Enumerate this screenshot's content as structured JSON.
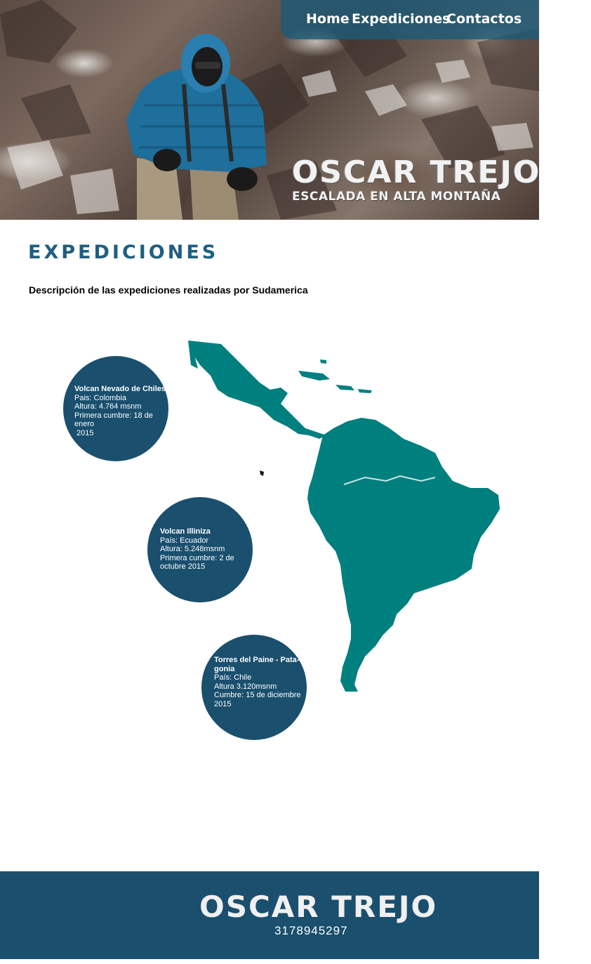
{
  "nav": {
    "items": [
      {
        "label": "Home"
      },
      {
        "label": "Expediciones"
      },
      {
        "label": "Contactos"
      }
    ]
  },
  "hero": {
    "name": "OSCAR TREJO",
    "tagline": "ESCALADA EN ALTA MONTAÑA"
  },
  "section": {
    "title": "EXPEDICIONES",
    "description": "Descripción de las expediciones realizadas por Sudamerica"
  },
  "expeditions": [
    {
      "name": "Volcan Nevado de Chiles",
      "lines": [
        "Pais: Colombia",
        "Altura: 4.764 msnm",
        "Primera cumbre: 18 de enero",
        " 2015"
      ]
    },
    {
      "name": "Volcan Illiniza",
      "lines": [
        "País: Ecuador",
        "Altura: 5.248msnm",
        "Primera cumbre: 2 de",
        "octubre 2015"
      ]
    },
    {
      "name": "Torres del Paine - Pata-",
      "name2": "gonia",
      "lines": [
        "País: Chile",
        "Altura 3.120msnm",
        "Cumbre: 15 de diciembre",
        "2015"
      ]
    }
  ],
  "footer": {
    "name": "OSCAR TREJO",
    "phone": "3178945297"
  },
  "colors": {
    "accent": "#1a4f6e",
    "map": "#007f7f",
    "nav_bg": "#1e5a78"
  }
}
